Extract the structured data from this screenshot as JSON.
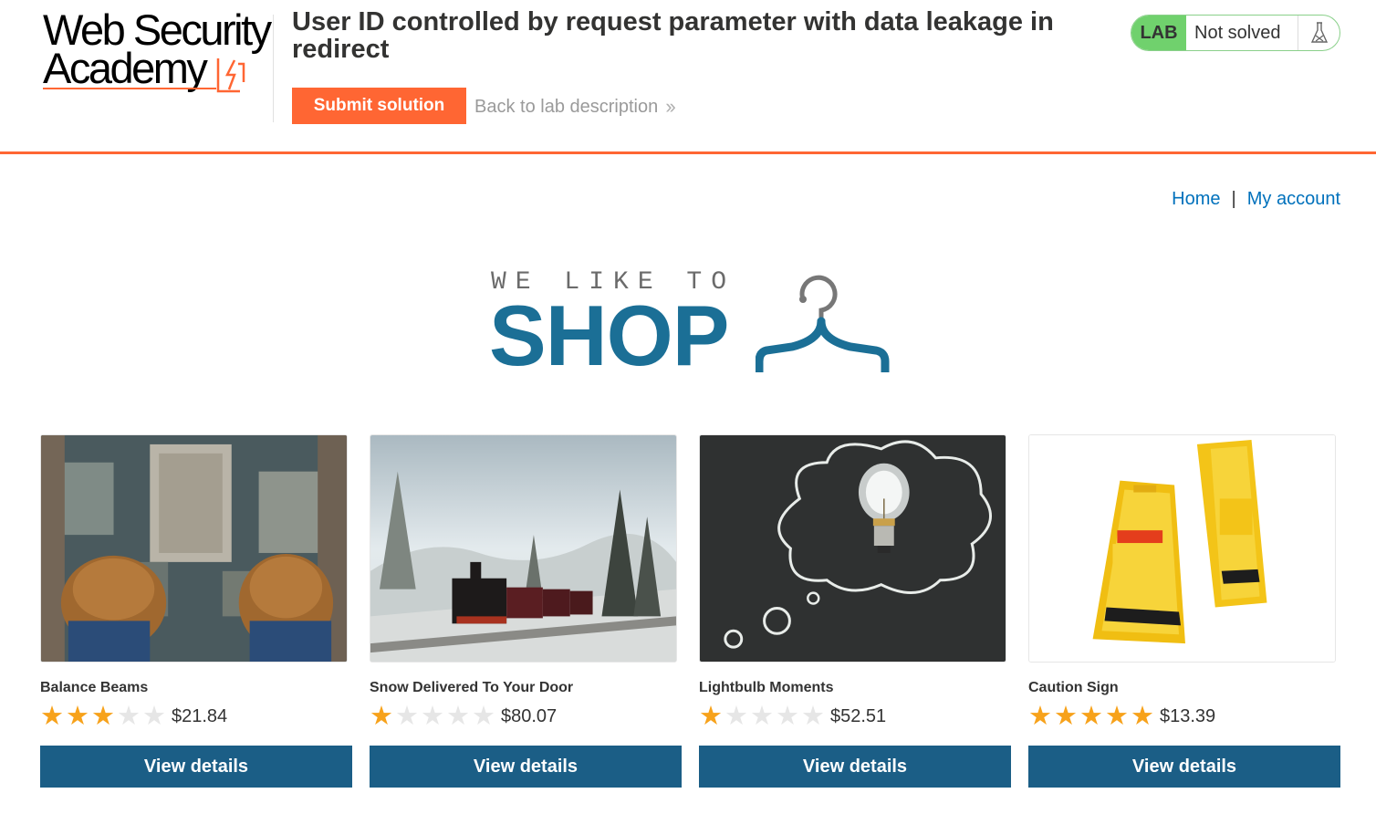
{
  "academy": {
    "logo_line1": "Web Security",
    "logo_line2": "Academy",
    "lab_title": "User ID controlled by request parameter with data leakage in redirect",
    "submit_label": "Submit solution",
    "back_label": "Back to lab description",
    "back_icon": "double-chevron-right",
    "lab_badge": {
      "tag": "LAB",
      "status": "Not solved",
      "icon": "flask-icon"
    },
    "accent_color": "#ff6633"
  },
  "nav": {
    "home": "Home",
    "separator": "|",
    "account": "My account",
    "link_color": "#0071bc"
  },
  "banner": {
    "small_text": "WE LIKE TO",
    "big_text": "SHOP",
    "icon": "hanger-icon",
    "color": "#1b6f96"
  },
  "products": [
    {
      "name": "Balance Beams",
      "rating": 3,
      "max_rating": 5,
      "price": "$21.84",
      "button": "View details",
      "image": "shoes-over-city"
    },
    {
      "name": "Snow Delivered To Your Door",
      "rating": 1,
      "max_rating": 5,
      "price": "$80.07",
      "button": "View details",
      "image": "steam-train-in-snow"
    },
    {
      "name": "Lightbulb Moments",
      "rating": 1,
      "max_rating": 5,
      "price": "$52.51",
      "button": "View details",
      "image": "lightbulb-chalk-cloud"
    },
    {
      "name": "Caution Sign",
      "rating": 5,
      "max_rating": 5,
      "price": "$13.39",
      "button": "View details",
      "image": "yellow-caution-signs"
    }
  ],
  "colors": {
    "star_on": "#f7a21b",
    "star_off": "#e6e6e6",
    "button": "#1b5e86",
    "lab_green": "#70d16d"
  }
}
